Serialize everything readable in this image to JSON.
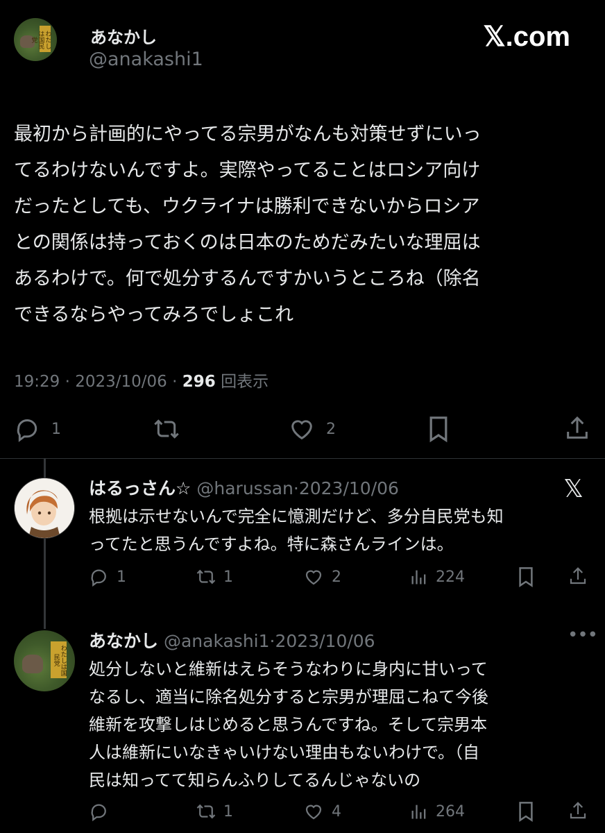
{
  "brand": {
    "logo_text": "𝕏.com"
  },
  "main_tweet": {
    "display_name": "あなかし",
    "handle": "@anakashi1",
    "avatar_label": "わたしは国民党",
    "lines": [
      "最初から計画的にやってる宗男がなんも対策せずにいっ",
      "てるわけないんですよ。実際やってることはロシア向け",
      "だったとしても、ウクライナは勝利できないからロシア",
      "との関係は持っておくのは日本のためだみたいな理屈は",
      "あるわけで。何で処分するんですかいうところね（除名",
      "できるならやってみろでしょこれ"
    ],
    "time": "19:29",
    "date": "2023/10/06",
    "sep": "·",
    "views_count": "296",
    "views_label": "回表示",
    "replies": "1",
    "likes": "2"
  },
  "reply1": {
    "display_name": "はるっさん☆",
    "handle": "@harussan",
    "sep": "·",
    "date": "2023/10/06",
    "lines": [
      "根拠は示せないんで完全に憶測だけど、多分自民党も知",
      "ってたと思うんですよね。特に森さんラインは。"
    ],
    "replies": "1",
    "retweets": "1",
    "likes": "2",
    "views": "224"
  },
  "reply2": {
    "display_name": "あなかし",
    "handle": "@anakashi1",
    "sep": "·",
    "date": "2023/10/06",
    "lines": [
      "処分しないと維新はえらそうなわりに身内に甘いって",
      "なるし、適当に除名処分すると宗男が理屈こねて今後",
      "維新を攻撃しはじめると思うんですね。そして宗男本",
      "人は維新にいなきゃいけない理由もないわけで。（自",
      "民は知ってて知らんふりしてるんじゃないの"
    ],
    "retweets": "1",
    "likes": "4",
    "views": "264"
  }
}
